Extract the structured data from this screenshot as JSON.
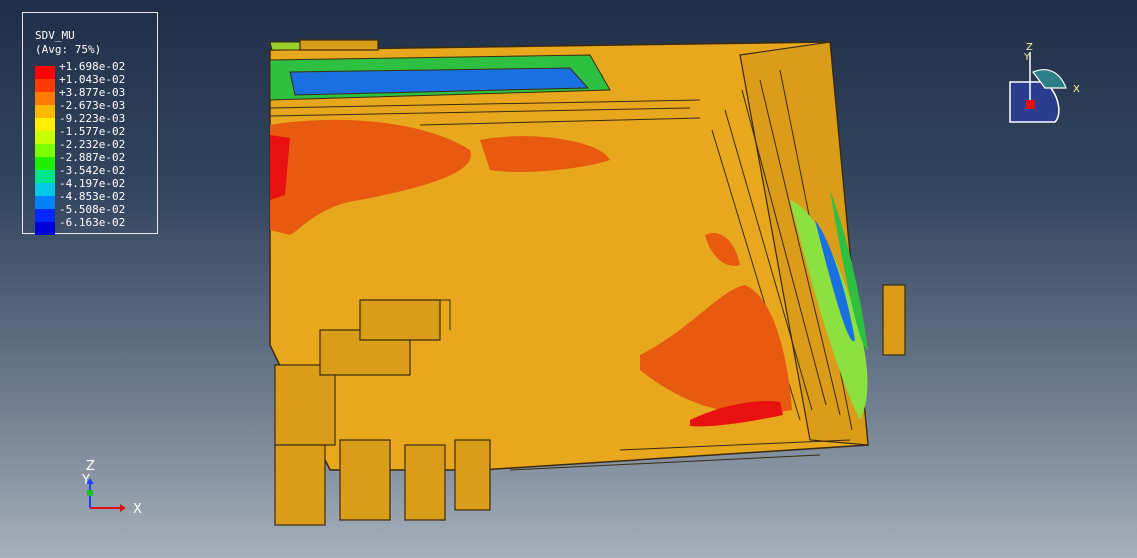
{
  "legend": {
    "variable": "SDV_MU",
    "averaging": "(Avg: 75%)",
    "entries": [
      {
        "label": "+1.698e-02",
        "color": "#ff0000"
      },
      {
        "label": "+1.043e-02",
        "color": "#ff3a00"
      },
      {
        "label": "+3.877e-03",
        "color": "#ff7c00"
      },
      {
        "label": "-2.673e-03",
        "color": "#ffba00"
      },
      {
        "label": "-9.223e-03",
        "color": "#ffee00"
      },
      {
        "label": "-1.577e-02",
        "color": "#c8ff00"
      },
      {
        "label": "-2.232e-02",
        "color": "#7cff00"
      },
      {
        "label": "-2.887e-02",
        "color": "#1cf000"
      },
      {
        "label": "-3.542e-02",
        "color": "#00e68c"
      },
      {
        "label": "-4.197e-02",
        "color": "#00c8e6"
      },
      {
        "label": "-4.853e-02",
        "color": "#0080ff"
      },
      {
        "label": "-5.508e-02",
        "color": "#0028ff"
      },
      {
        "label": "-6.163e-02",
        "color": "#0000d8"
      }
    ]
  },
  "triad": {
    "x": "X",
    "y": "Y",
    "z": "Z"
  },
  "view_cube": {
    "x": "X",
    "y": "Y",
    "z": "Z"
  },
  "colors": {
    "model_base": "#e8a81e",
    "model_edge": "#3b2a10",
    "hot": "#e85a10",
    "hotter": "#e81010"
  }
}
